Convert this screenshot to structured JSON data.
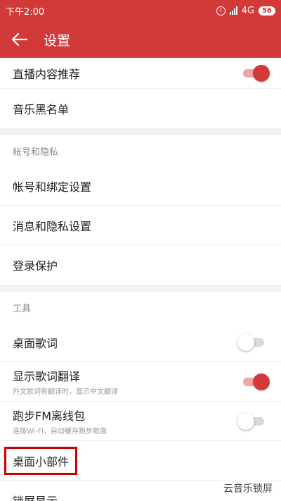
{
  "statusbar": {
    "time": "下午2:00",
    "network": "4G",
    "battery": "56"
  },
  "appbar": {
    "title": "设置"
  },
  "sections": {
    "top": {
      "rows": [
        {
          "label": "直播内容推荐",
          "toggle": true
        },
        {
          "label": "音乐黑名单"
        }
      ]
    },
    "account": {
      "header": "帐号和隐私",
      "rows": [
        {
          "label": "帐号和绑定设置"
        },
        {
          "label": "消息和隐私设置"
        },
        {
          "label": "登录保护"
        }
      ]
    },
    "tools": {
      "header": "工具",
      "rows": [
        {
          "label": "桌面歌词",
          "toggle": false
        },
        {
          "label": "显示歌词翻译",
          "sub": "外文歌词有翻译时，显示中文翻译",
          "toggle": true
        },
        {
          "label": "跑步FM离线包",
          "sub": "连接Wi-Fi，自动缓存跑步歌曲",
          "toggle": false
        },
        {
          "label": "桌面小部件"
        },
        {
          "label": "锁屏显示"
        }
      ]
    }
  },
  "watermark": {
    "text": "云音乐锁屏"
  },
  "colors": {
    "brand": "#d23a3a",
    "highlight": "#cc0000"
  }
}
